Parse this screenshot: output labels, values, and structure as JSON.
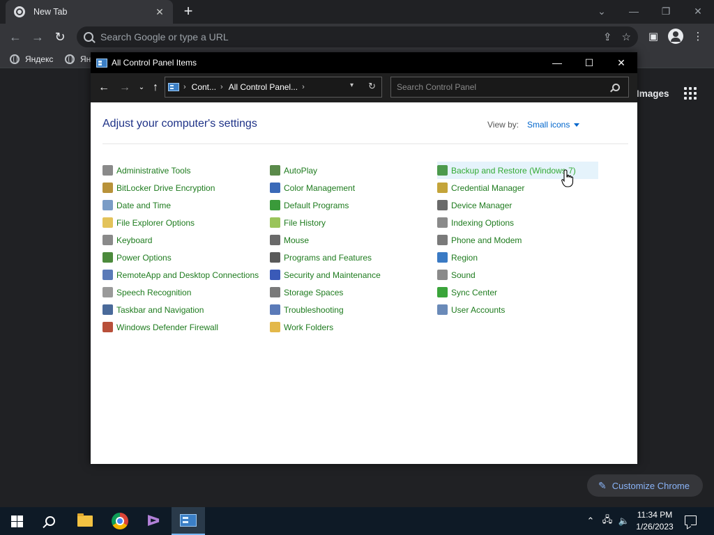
{
  "browser": {
    "tab_title": "New Tab",
    "tab_close": "✕",
    "new_tab": "+",
    "omnibox_placeholder": "Search Google or type a URL",
    "bookmarks": [
      {
        "label": "Яндекс"
      },
      {
        "label": "Ян"
      }
    ],
    "ntp_images_link": "Images",
    "customize_label": "Customize Chrome"
  },
  "control_panel": {
    "window_title": "All Control Panel Items",
    "address": {
      "crumbs": [
        "Cont...",
        "All Control Panel..."
      ]
    },
    "search_placeholder": "Search Control Panel",
    "heading": "Adjust your computer's settings",
    "view_by_label": "View by:",
    "view_by_value": "Small icons",
    "columns": [
      [
        {
          "label": "Administrative Tools",
          "icon": "admin-tools-icon",
          "color": "#8a8a8a"
        },
        {
          "label": "BitLocker Drive Encryption",
          "icon": "bitlocker-icon",
          "color": "#b8923a"
        },
        {
          "label": "Date and Time",
          "icon": "clock-icon",
          "color": "#7a9cc6"
        },
        {
          "label": "File Explorer Options",
          "icon": "folder-options-icon",
          "color": "#e3c35a"
        },
        {
          "label": "Keyboard",
          "icon": "keyboard-icon",
          "color": "#8a8a8a"
        },
        {
          "label": "Power Options",
          "icon": "power-icon",
          "color": "#4c8a3c"
        },
        {
          "label": "RemoteApp and Desktop Connections",
          "icon": "remoteapp-icon",
          "color": "#5a7ab8"
        },
        {
          "label": "Speech Recognition",
          "icon": "microphone-icon",
          "color": "#9a9a9a"
        },
        {
          "label": "Taskbar and Navigation",
          "icon": "taskbar-icon",
          "color": "#4a6a9a"
        },
        {
          "label": "Windows Defender Firewall",
          "icon": "firewall-icon",
          "color": "#b8503a"
        }
      ],
      [
        {
          "label": "AutoPlay",
          "icon": "autoplay-icon",
          "color": "#5a8a4a"
        },
        {
          "label": "Color Management",
          "icon": "color-management-icon",
          "color": "#3a6ab8"
        },
        {
          "label": "Default Programs",
          "icon": "default-programs-icon",
          "color": "#3a9a3a"
        },
        {
          "label": "File History",
          "icon": "file-history-icon",
          "color": "#9ac45a"
        },
        {
          "label": "Mouse",
          "icon": "mouse-icon",
          "color": "#6a6a6a"
        },
        {
          "label": "Programs and Features",
          "icon": "programs-icon",
          "color": "#5a5a5a"
        },
        {
          "label": "Security and Maintenance",
          "icon": "flag-icon",
          "color": "#3a5ab8"
        },
        {
          "label": "Storage Spaces",
          "icon": "storage-icon",
          "color": "#7a7a7a"
        },
        {
          "label": "Troubleshooting",
          "icon": "troubleshoot-icon",
          "color": "#5a7ab8"
        },
        {
          "label": "Work Folders",
          "icon": "work-folders-icon",
          "color": "#e3b84a"
        }
      ],
      [
        {
          "label": "Backup and Restore (Windows 7)",
          "icon": "backup-icon",
          "color": "#4c9a4c",
          "highlight": true
        },
        {
          "label": "Credential Manager",
          "icon": "credential-icon",
          "color": "#c4a43a"
        },
        {
          "label": "Device Manager",
          "icon": "device-manager-icon",
          "color": "#6a6a6a"
        },
        {
          "label": "Indexing Options",
          "icon": "indexing-icon",
          "color": "#8a8a8a"
        },
        {
          "label": "Phone and Modem",
          "icon": "phone-icon",
          "color": "#7a7a7a"
        },
        {
          "label": "Region",
          "icon": "globe-icon",
          "color": "#3a7ac4"
        },
        {
          "label": "Sound",
          "icon": "speaker-icon",
          "color": "#8a8a8a"
        },
        {
          "label": "Sync Center",
          "icon": "sync-icon",
          "color": "#3aa43a"
        },
        {
          "label": "User Accounts",
          "icon": "users-icon",
          "color": "#6a8ab8"
        }
      ]
    ]
  },
  "taskbar": {
    "time": "11:34 PM",
    "date": "1/26/2023",
    "vs_glyph": "ᐅ"
  }
}
